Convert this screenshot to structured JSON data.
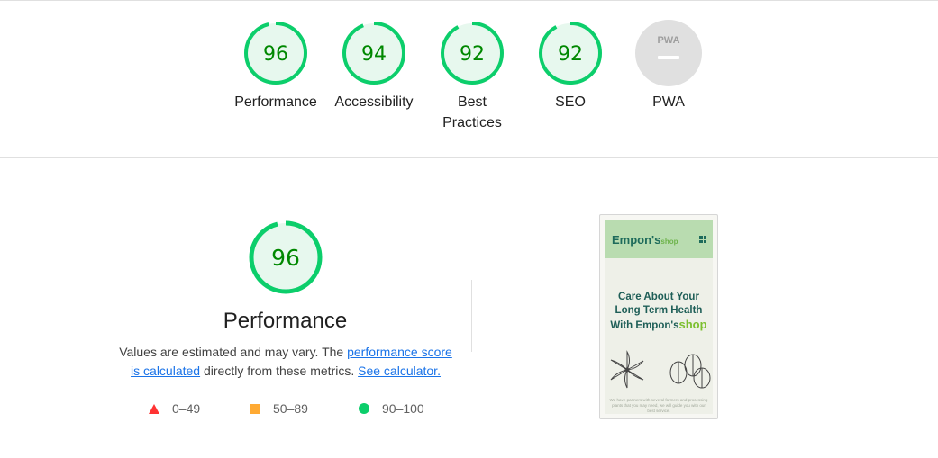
{
  "colors": {
    "pass": "#0cce6b",
    "pass_text": "#008800",
    "pass_fill": "#e7f8ee",
    "average": "#ffaa33",
    "fail": "#ff3333",
    "na_fill": "#e0e0e0",
    "link": "#1a73e8"
  },
  "categories": [
    {
      "label": "Performance",
      "score": "96",
      "percent": 96
    },
    {
      "label": "Accessibility",
      "score": "94",
      "percent": 94
    },
    {
      "label": "Best Practices",
      "score": "92",
      "percent": 92
    },
    {
      "label": "SEO",
      "score": "92",
      "percent": 92
    },
    {
      "label": "PWA",
      "score": "",
      "badge": "PWA",
      "percent": null
    }
  ],
  "performance": {
    "score": "96",
    "percent": 96,
    "title": "Performance",
    "desc_prefix": "Values are estimated and may vary. The ",
    "link1": "performance score is calculated",
    "desc_middle": " directly from these metrics. ",
    "link2": "See calculator."
  },
  "legend": [
    {
      "icon": "red-triangle-icon",
      "range": "0–49"
    },
    {
      "icon": "orange-square-icon",
      "range": "50–89"
    },
    {
      "icon": "green-circle-icon",
      "range": "90–100"
    }
  ],
  "screenshot": {
    "brand_main": "Empon's",
    "brand_sub": "shop",
    "hero_line1": "Care About Your",
    "hero_line2": "Long Term Health",
    "hero_line3_prefix": "With Empon's",
    "hero_line3_accent": "shop",
    "body_text": "We have partners with several farmers and processing plants that you may need, we will guide you with our best service."
  }
}
